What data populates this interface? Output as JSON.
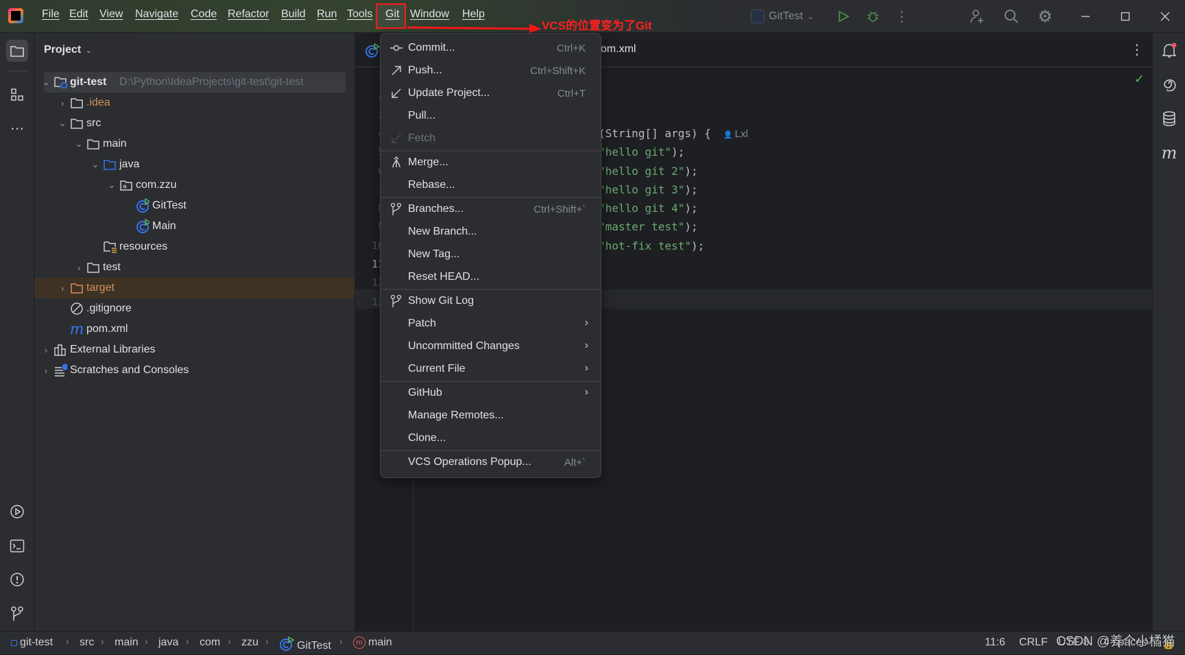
{
  "menubar": {
    "items": [
      "File",
      "Edit",
      "View",
      "Navigate",
      "Code",
      "Refactor",
      "Build",
      "Run",
      "Tools",
      "Git",
      "Window",
      "Help"
    ],
    "highlighted": "Git"
  },
  "annotation": {
    "text": "VCS的位置变为了Git",
    "color": "#ff2020"
  },
  "toolbar": {
    "run_config": "GitTest",
    "icons": [
      "run-icon",
      "debug-icon",
      "more-icon",
      "add-user-icon",
      "search-icon",
      "gear-icon",
      "minimize-icon",
      "maximize-icon",
      "close-icon"
    ]
  },
  "project": {
    "title": "Project",
    "tree": [
      {
        "label": "git-test",
        "path": "D:\\Python\\IdeaProjects\\git-test\\git-test",
        "level": 0,
        "chevron": "down",
        "icon": "module-folder",
        "bold": true,
        "selected": true
      },
      {
        "label": ".idea",
        "level": 1,
        "chevron": "right",
        "icon": "folder",
        "color": "#d5915c"
      },
      {
        "label": "src",
        "level": 1,
        "chevron": "down",
        "icon": "folder"
      },
      {
        "label": "main",
        "level": 2,
        "chevron": "down",
        "icon": "folder"
      },
      {
        "label": "java",
        "level": 3,
        "chevron": "down",
        "icon": "source-folder"
      },
      {
        "label": "com.zzu",
        "level": 4,
        "chevron": "down",
        "icon": "package"
      },
      {
        "label": "GitTest",
        "level": 5,
        "icon": "java-class"
      },
      {
        "label": "Main",
        "level": 5,
        "icon": "java-class"
      },
      {
        "label": "resources",
        "level": 3,
        "icon": "resources-folder"
      },
      {
        "label": "test",
        "level": 2,
        "chevron": "right",
        "icon": "folder"
      },
      {
        "label": "target",
        "level": 1,
        "chevron": "right",
        "icon": "excluded-folder",
        "color": "#d5915c",
        "highlight": true
      },
      {
        "label": ".gitignore",
        "level": 1,
        "icon": "ignore-file"
      },
      {
        "label": "pom.xml",
        "level": 1,
        "icon": "maven"
      },
      {
        "label": "External Libraries",
        "level": 0,
        "chevron": "right",
        "icon": "library"
      },
      {
        "label": "Scratches and Consoles",
        "level": 0,
        "chevron": "right",
        "icon": "scratches"
      }
    ]
  },
  "editor": {
    "tab_visible": "pom.xml",
    "line_numbers": [
      "1",
      "2",
      "3",
      "4",
      "5",
      "6",
      "7",
      "8",
      "9",
      "10",
      "11",
      "12",
      "13"
    ],
    "current_line": 11,
    "code": [
      {
        "line": 4,
        "parts": [
          {
            "t": "(String[] args) {",
            "k": "plain"
          }
        ],
        "author": "Lxl"
      },
      {
        "line": 5,
        "parts": [
          {
            "t": "\"hello git\"",
            "k": "str"
          },
          {
            "t": ");",
            "k": "plain"
          }
        ]
      },
      {
        "line": 6,
        "parts": [
          {
            "t": "\"hello git 2\"",
            "k": "str"
          },
          {
            "t": ");",
            "k": "plain"
          }
        ]
      },
      {
        "line": 7,
        "parts": [
          {
            "t": "\"hello git 3\"",
            "k": "str"
          },
          {
            "t": ");",
            "k": "plain"
          }
        ]
      },
      {
        "line": 8,
        "parts": [
          {
            "t": "\"hello git 4\"",
            "k": "str"
          },
          {
            "t": ");",
            "k": "plain"
          }
        ]
      },
      {
        "line": 9,
        "parts": [
          {
            "t": "\"master test\"",
            "k": "str"
          },
          {
            "t": ");",
            "k": "plain"
          }
        ]
      },
      {
        "line": 10,
        "parts": [
          {
            "t": "\"hot-fix test\"",
            "k": "str"
          },
          {
            "t": ");",
            "k": "plain"
          }
        ]
      }
    ]
  },
  "git_menu": {
    "groups": [
      [
        {
          "label": "Commit...",
          "shortcut": "Ctrl+K",
          "icon": "commit-icon"
        },
        {
          "label": "Push...",
          "shortcut": "Ctrl+Shift+K",
          "icon": "push-icon"
        },
        {
          "label": "Update Project...",
          "shortcut": "Ctrl+T",
          "icon": "update-icon"
        },
        {
          "label": "Pull..."
        },
        {
          "label": "Fetch",
          "icon": "fetch-icon",
          "disabled": true
        }
      ],
      [
        {
          "label": "Merge...",
          "icon": "merge-icon"
        },
        {
          "label": "Rebase..."
        }
      ],
      [
        {
          "label": "Branches...",
          "shortcut": "Ctrl+Shift+`",
          "icon": "branch-icon"
        },
        {
          "label": "New Branch..."
        },
        {
          "label": "New Tag..."
        },
        {
          "label": "Reset HEAD..."
        }
      ],
      [
        {
          "label": "Show Git Log",
          "icon": "git-log-icon"
        },
        {
          "label": "Patch",
          "submenu": true
        },
        {
          "label": "Uncommitted Changes",
          "submenu": true
        },
        {
          "label": "Current File",
          "submenu": true
        }
      ],
      [
        {
          "label": "GitHub",
          "submenu": true
        },
        {
          "label": "Manage Remotes..."
        },
        {
          "label": "Clone..."
        }
      ],
      [
        {
          "label": "VCS Operations Popup...",
          "shortcut": "Alt+`"
        }
      ]
    ]
  },
  "statusbar": {
    "breadcrumbs": [
      "git-test",
      "src",
      "main",
      "java",
      "com",
      "zzu",
      "GitTest",
      "main"
    ],
    "position": "11:6",
    "line_ending": "CRLF",
    "encoding": "UTF-8",
    "indent": "4 spaces"
  },
  "watermark": "CSDN @养个小橘猫",
  "colors": {
    "accent": "#3574f0",
    "string": "#6aab73",
    "excluded": "#d5915c",
    "annotation": "#ff2020"
  }
}
